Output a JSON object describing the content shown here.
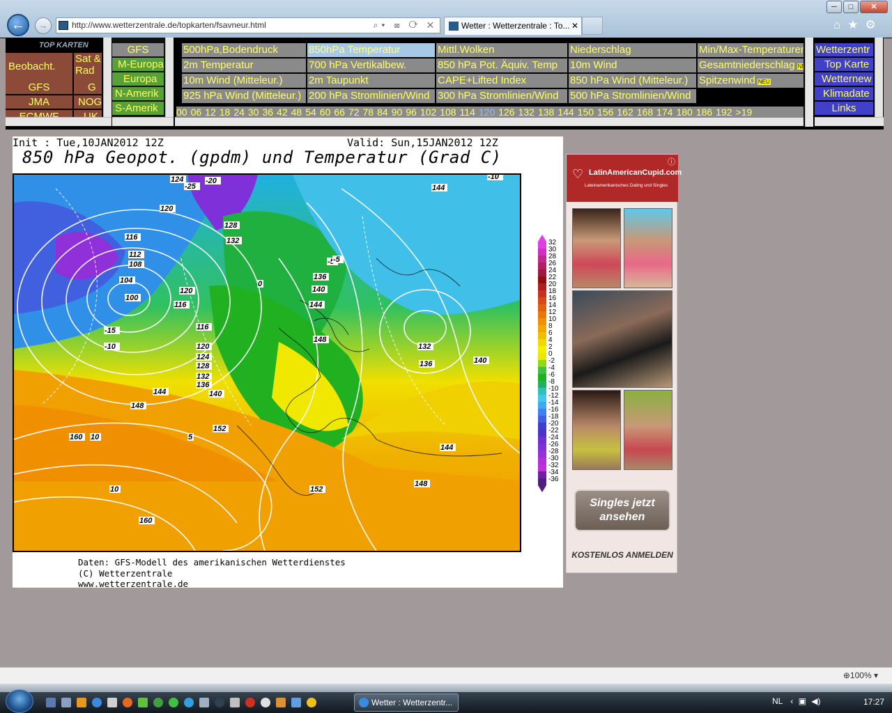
{
  "window": {
    "minimize": "─",
    "maximize": "□",
    "close": "✕"
  },
  "browser": {
    "back_icon": "←",
    "forward_icon": "→",
    "url": "http://www.wetterzentrale.de/topkarten/fsavneur.html",
    "address_icons": "⌕▾ ⊠ ⟳ ✕",
    "tab_title": "Wetter : Wetterzentrale : To...",
    "tab_close": "✕",
    "home_icon": "⌂",
    "favorites_icon": "★",
    "tools_icon": "⚙"
  },
  "nav": {
    "frame1": {
      "logo": "TOP KARTEN",
      "rows": [
        [
          "Beobacht.",
          "Sat & Rad"
        ],
        [
          "GFS",
          "G"
        ],
        [
          "JMA",
          "NOG"
        ],
        [
          "ECMWF",
          "UK"
        ]
      ]
    },
    "frame2": [
      "GFS",
      "M-Europa",
      "Europa",
      "N-Amerik",
      "S-Amerik"
    ],
    "frame3": [
      [
        "500hPa,Bodendruck",
        "850hPa Temperatur",
        "Mittl.Wolken",
        "Niederschlag",
        "Min/Max-Temperaturen"
      ],
      [
        "2m Temperatur",
        "700 hPa Vertikalbew.",
        "850 hPa Pot. Äquiv. Temp",
        "10m Wind",
        "Gesamtniederschlag"
      ],
      [
        "10m Wind (Mitteleur.)",
        "2m Taupunkt",
        "CAPE+Lifted Index",
        "850 hPa Wind (Mitteleur.)",
        "Spitzenwind"
      ],
      [
        "925 hPa Wind (Mitteleur.)",
        "200 hPa Stromlinien/Wind",
        "300 hPa Stromlinien/Wind",
        "500 hPa Stromlinien/Wind",
        ""
      ]
    ],
    "badge_neu": "NEU",
    "hours": [
      "00",
      "06",
      "12",
      "18",
      "24",
      "30",
      "36",
      "42",
      "48",
      "54",
      "60",
      "66",
      "72",
      "78",
      "84",
      "90",
      "96",
      "102",
      "108",
      "114",
      "120",
      "126",
      "132",
      "138",
      "144",
      "150",
      "156",
      "162",
      "168",
      "174",
      "180",
      "186",
      "192",
      ">19"
    ],
    "current_hour": "120",
    "frame4": [
      "Wetterzentr",
      "Top Karte",
      "Wetternew",
      "Klimadate",
      "Links"
    ]
  },
  "map": {
    "init": "Init : Tue,10JAN2012 12Z",
    "valid": "Valid: Sun,15JAN2012 12Z",
    "title": "850 hPa Geopot. (gpdm) und Temperatur (Grad C)",
    "credits": [
      "Daten: GFS-Modell des amerikanischen Wetterdienstes",
      "(C) Wetterzentrale",
      "www.wetterzentrale.de"
    ],
    "legend_values": [
      "32",
      "30",
      "28",
      "26",
      "24",
      "22",
      "20",
      "18",
      "16",
      "14",
      "12",
      "10",
      "8",
      "6",
      "4",
      "2",
      "0",
      "-2",
      "-4",
      "-6",
      "-8",
      "-10",
      "-12",
      "-14",
      "-16",
      "-18",
      "-20",
      "-22",
      "-24",
      "-26",
      "-28",
      "-30",
      "-32",
      "-34",
      "-36"
    ],
    "legend_colors": [
      "#e040e0",
      "#d030c0",
      "#c02890",
      "#b02060",
      "#a01840",
      "#901010",
      "#b02020",
      "#c83020",
      "#d84818",
      "#e06010",
      "#e87808",
      "#f09000",
      "#f0a800",
      "#f0c000",
      "#f0d800",
      "#f0f000",
      "#e8e800",
      "#90d820",
      "#40c040",
      "#20b020",
      "#20b060",
      "#30c0c0",
      "#40c8e8",
      "#40a8f0",
      "#4080f0",
      "#4060e0",
      "#4040d0",
      "#5030c8",
      "#7030d0",
      "#8030d8",
      "#9830d8",
      "#b030d8",
      "#c030d8",
      "#7020a0",
      "#502080"
    ],
    "isotherm_labels": [
      {
        "t": "124"
      },
      {
        "t": "-25"
      },
      {
        "t": "-20"
      },
      {
        "t": "144"
      },
      {
        "t": "-10"
      },
      {
        "t": "120"
      },
      {
        "t": "128"
      },
      {
        "t": "132"
      },
      {
        "t": "116"
      },
      {
        "t": "112"
      },
      {
        "t": "108"
      },
      {
        "t": "104"
      },
      {
        "t": "100"
      },
      {
        "t": "120"
      },
      {
        "t": "116"
      },
      {
        "t": "136"
      },
      {
        "t": "140"
      },
      {
        "t": "144"
      },
      {
        "t": "-5"
      },
      {
        "t": "0"
      },
      {
        "t": "148"
      },
      {
        "t": "132"
      },
      {
        "t": "136"
      },
      {
        "t": "140"
      },
      {
        "t": "116"
      },
      {
        "t": "120"
      },
      {
        "t": "124"
      },
      {
        "t": "128"
      },
      {
        "t": "132"
      },
      {
        "t": "136"
      },
      {
        "t": "140"
      },
      {
        "t": "144"
      },
      {
        "t": "148"
      },
      {
        "t": "152"
      },
      {
        "t": "160"
      },
      {
        "t": "10"
      },
      {
        "t": "5"
      },
      {
        "t": "152"
      },
      {
        "t": "148"
      },
      {
        "t": "144"
      },
      {
        "t": "160"
      },
      {
        "t": "10"
      },
      {
        "t": "-15"
      },
      {
        "t": "-10"
      },
      {
        "t": "-5"
      }
    ]
  },
  "ad": {
    "brand": "LatinAmericanCupid.com",
    "tagline": "Lateinamerikanisches Dating und Singles",
    "info_icon": "ⓘ",
    "button": "Singles jetzt ansehen",
    "footer": "KOSTENLOS ANMELDEN"
  },
  "status": {
    "zoom": "100%"
  },
  "taskbar": {
    "task_label": "Wetter : Wetterzentr...",
    "tray": "NL",
    "clock": "17:27"
  }
}
